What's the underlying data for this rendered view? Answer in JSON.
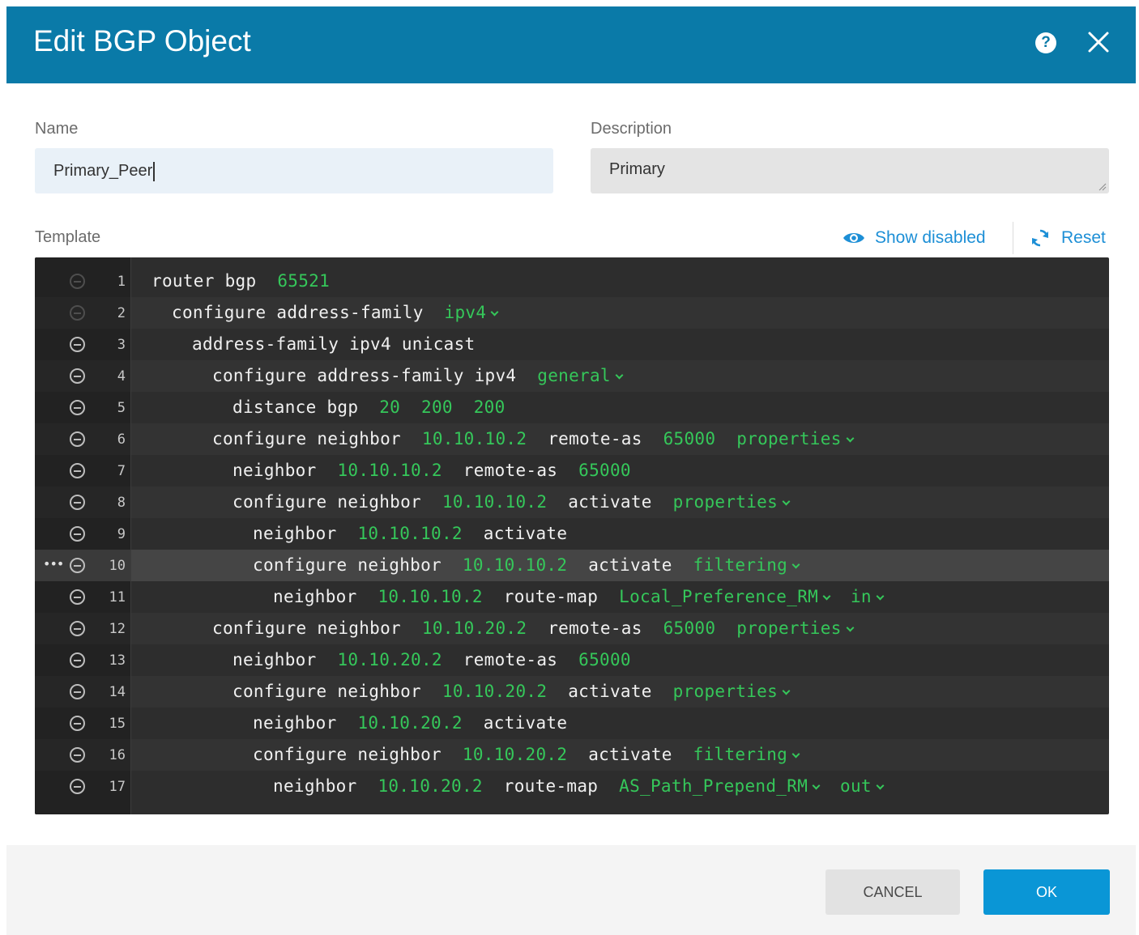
{
  "dialog": {
    "title": "Edit BGP Object",
    "help_icon": "question-circle-icon",
    "close_icon": "close-x-icon",
    "header_color": "#0a7aa8"
  },
  "form": {
    "name_label": "Name",
    "name_value": "Primary_Peer",
    "description_label": "Description",
    "description_value": "Primary",
    "template_label": "Template",
    "show_disabled_label": "Show disabled",
    "show_disabled_icon": "eye-icon",
    "reset_label": "Reset",
    "reset_icon": "refresh-icon"
  },
  "editor": {
    "lines": [
      {
        "n": "1",
        "indent": 0,
        "active": false,
        "tokens": [
          {
            "t": "router bgp",
            "c": "w"
          },
          {
            "t": "65521",
            "c": "g"
          }
        ]
      },
      {
        "n": "2",
        "indent": 1,
        "active": false,
        "tokens": [
          {
            "t": "configure address-family",
            "c": "w"
          },
          {
            "t": "ipv4",
            "c": "g",
            "dd": true
          }
        ]
      },
      {
        "n": "3",
        "indent": 2,
        "active": true,
        "tokens": [
          {
            "t": "address-family ipv4 unicast",
            "c": "w"
          }
        ]
      },
      {
        "n": "4",
        "indent": 3,
        "active": true,
        "tokens": [
          {
            "t": "configure address-family ipv4",
            "c": "w"
          },
          {
            "t": "general",
            "c": "g",
            "dd": true
          }
        ]
      },
      {
        "n": "5",
        "indent": 4,
        "active": true,
        "tokens": [
          {
            "t": "distance bgp",
            "c": "w"
          },
          {
            "t": "20",
            "c": "g"
          },
          {
            "t": "200",
            "c": "g"
          },
          {
            "t": "200",
            "c": "g"
          }
        ]
      },
      {
        "n": "6",
        "indent": 3,
        "active": true,
        "tokens": [
          {
            "t": "configure neighbor",
            "c": "w"
          },
          {
            "t": "10.10.10.2",
            "c": "g"
          },
          {
            "t": "remote-as",
            "c": "w"
          },
          {
            "t": "65000",
            "c": "g"
          },
          {
            "t": "properties",
            "c": "g",
            "dd": true
          }
        ]
      },
      {
        "n": "7",
        "indent": 4,
        "active": true,
        "tokens": [
          {
            "t": "neighbor",
            "c": "w"
          },
          {
            "t": "10.10.10.2",
            "c": "g"
          },
          {
            "t": "remote-as",
            "c": "w"
          },
          {
            "t": "65000",
            "c": "g"
          }
        ]
      },
      {
        "n": "8",
        "indent": 4,
        "active": true,
        "tokens": [
          {
            "t": "configure neighbor",
            "c": "w"
          },
          {
            "t": "10.10.10.2",
            "c": "g"
          },
          {
            "t": "activate",
            "c": "w"
          },
          {
            "t": "properties",
            "c": "g",
            "dd": true
          }
        ]
      },
      {
        "n": "9",
        "indent": 5,
        "active": true,
        "tokens": [
          {
            "t": "neighbor",
            "c": "w"
          },
          {
            "t": "10.10.10.2",
            "c": "g"
          },
          {
            "t": "activate",
            "c": "w"
          }
        ]
      },
      {
        "n": "10",
        "indent": 5,
        "active": true,
        "highlight": true,
        "dots": "•••",
        "tokens": [
          {
            "t": "configure neighbor",
            "c": "w"
          },
          {
            "t": "10.10.10.2",
            "c": "g"
          },
          {
            "t": "activate",
            "c": "w"
          },
          {
            "t": "filtering",
            "c": "g",
            "dd": true
          }
        ]
      },
      {
        "n": "11",
        "indent": 6,
        "active": true,
        "tokens": [
          {
            "t": "neighbor",
            "c": "w"
          },
          {
            "t": "10.10.10.2",
            "c": "g"
          },
          {
            "t": "route-map",
            "c": "w"
          },
          {
            "t": "Local_Preference_RM",
            "c": "g",
            "dd": true
          },
          {
            "t": "in",
            "c": "g",
            "dd": true
          }
        ]
      },
      {
        "n": "12",
        "indent": 3,
        "active": true,
        "tokens": [
          {
            "t": "configure neighbor",
            "c": "w"
          },
          {
            "t": "10.10.20.2",
            "c": "g"
          },
          {
            "t": "remote-as",
            "c": "w"
          },
          {
            "t": "65000",
            "c": "g"
          },
          {
            "t": "properties",
            "c": "g",
            "dd": true
          }
        ]
      },
      {
        "n": "13",
        "indent": 4,
        "active": true,
        "tokens": [
          {
            "t": "neighbor",
            "c": "w"
          },
          {
            "t": "10.10.20.2",
            "c": "g"
          },
          {
            "t": "remote-as",
            "c": "w"
          },
          {
            "t": "65000",
            "c": "g"
          }
        ]
      },
      {
        "n": "14",
        "indent": 4,
        "active": true,
        "tokens": [
          {
            "t": "configure neighbor",
            "c": "w"
          },
          {
            "t": "10.10.20.2",
            "c": "g"
          },
          {
            "t": "activate",
            "c": "w"
          },
          {
            "t": "properties",
            "c": "g",
            "dd": true
          }
        ]
      },
      {
        "n": "15",
        "indent": 5,
        "active": true,
        "tokens": [
          {
            "t": "neighbor",
            "c": "w"
          },
          {
            "t": "10.10.20.2",
            "c": "g"
          },
          {
            "t": "activate",
            "c": "w"
          }
        ]
      },
      {
        "n": "16",
        "indent": 5,
        "active": true,
        "tokens": [
          {
            "t": "configure neighbor",
            "c": "w"
          },
          {
            "t": "10.10.20.2",
            "c": "g"
          },
          {
            "t": "activate",
            "c": "w"
          },
          {
            "t": "filtering",
            "c": "g",
            "dd": true
          }
        ]
      },
      {
        "n": "17",
        "indent": 6,
        "active": true,
        "tokens": [
          {
            "t": "neighbor",
            "c": "w"
          },
          {
            "t": "10.10.20.2",
            "c": "g"
          },
          {
            "t": "route-map",
            "c": "w"
          },
          {
            "t": "AS_Path_Prepend_RM",
            "c": "g",
            "dd": true
          },
          {
            "t": "out",
            "c": "g",
            "dd": true
          }
        ]
      }
    ]
  },
  "footer": {
    "cancel_label": "CANCEL",
    "ok_label": "OK"
  },
  "colors": {
    "accent": "#0a96d6",
    "link": "#1d8fd6",
    "code_green": "#35c75a",
    "editor_bg": "#2d2d2d"
  }
}
